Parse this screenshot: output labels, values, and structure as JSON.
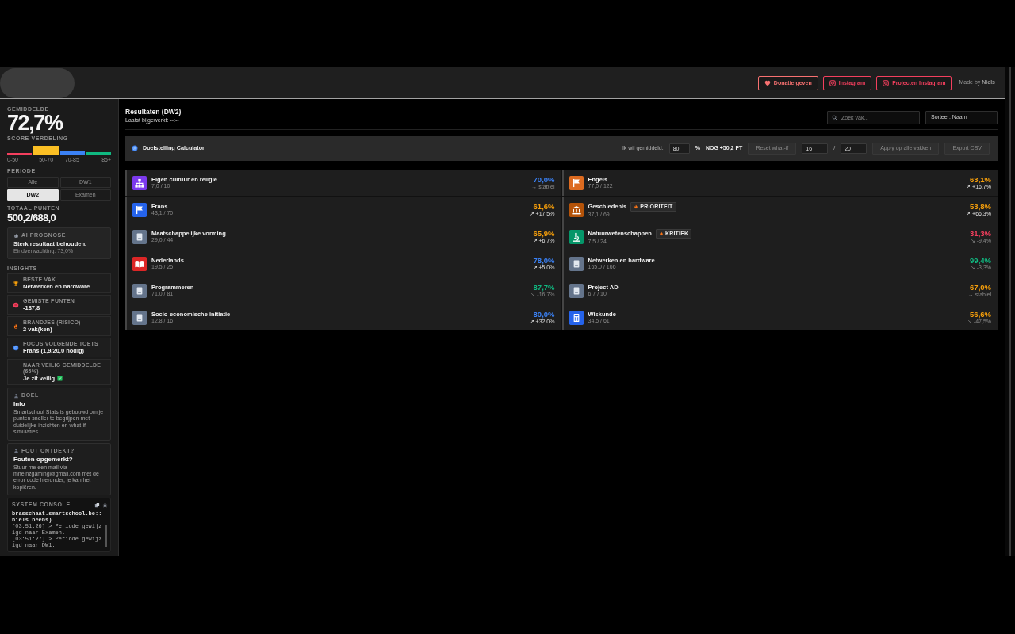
{
  "header": {
    "buttons": [
      {
        "label": "Donatie geven",
        "kind": "donate",
        "color": "#f87171"
      },
      {
        "label": "Instagram",
        "kind": "social",
        "color": "#f43f5e"
      },
      {
        "label": "Projecten Instagram",
        "kind": "social",
        "color": "#f43f5e"
      }
    ],
    "credit": "Made by **Niels**"
  },
  "sidebar": {
    "average": {
      "label": "GEMIDDELDE",
      "value": "72,7%"
    },
    "distribution": {
      "label": "SCORE VERDELING",
      "bins": [
        {
          "label": "0-50",
          "color": "#f43f5e"
        },
        {
          "label": "50-70",
          "color": "#fbbf24"
        },
        {
          "label": "70-85",
          "color": "#3b82f6"
        },
        {
          "label": "85+",
          "color": "#10b981"
        }
      ]
    },
    "period": {
      "label": "PERIODE",
      "options": [
        {
          "label": "Alle",
          "selected": false
        },
        {
          "label": "DW1",
          "selected": false
        },
        {
          "label": "DW2",
          "selected": true
        },
        {
          "label": "Examen",
          "selected": false
        }
      ]
    },
    "total": {
      "label": "TOTAAL PUNTEN",
      "value": "500,2/688,0"
    },
    "prognosis": {
      "label": "AI PROGNOSE",
      "headline": "Sterk resultaat behouden.",
      "detail": "Eindverwachting: 73,0%"
    },
    "insights": {
      "label": "INSIGHTS",
      "items": [
        {
          "kind": "trophy",
          "label": "BESTE VAK",
          "value": "Netwerken en hardware",
          "check": false
        },
        {
          "kind": "minus",
          "label": "GEMISTE PUNTEN",
          "value": "-187,8",
          "check": false
        },
        {
          "kind": "fire",
          "label": "BRANDJES (RISICO)",
          "value": "2 vak(ken)",
          "check": false
        },
        {
          "kind": "target",
          "label": "FOCUS VOLGENDE TOETS",
          "value": "Frans (1,9/20,0 nodig)",
          "check": false
        },
        {
          "kind": "none",
          "label": "NAAR VEILIG GEMIDDELDE (65%)",
          "value": "Je zit veilig",
          "check": true
        }
      ]
    },
    "info": {
      "label": "DOEL",
      "title": "Info",
      "text": "Smartschool Stats is gebouwd om je punten sneller te begrijpen met duidelijke inzichten en what-if simulaties."
    },
    "report": {
      "label": "FOUT ONTDEKT?",
      "title": "Fouten opgemerkt?",
      "text": "Stuur me een mail via mneinzgaming@gmail.com met de error code hieronder, je kan het kopiëren."
    },
    "console": {
      "title": "SYSTEM CONSOLE",
      "lines": [
        "brasschaat.smartschool.be::niels heens).",
        "[03:51:26] > Periode gewijzigd naar Examen.",
        "[03:51:27] > Periode gewijzigd naar DW1."
      ]
    }
  },
  "main": {
    "title": "Resultaten (DW2)",
    "updated": "Laatst bijgewerkt: --:--",
    "search": {
      "placeholder": "Zoek vak..."
    },
    "sort": {
      "value": "Sorteer: Naam"
    },
    "calculator": {
      "title": "Doelstelling Calculator",
      "target_label": "Ik wil gemiddeld:",
      "target": "80",
      "unit": "%",
      "needed": "NOG +50,2 PT",
      "reset": {
        "label": "Reset what-if",
        "disabled": true
      },
      "score": "16",
      "separator": "/",
      "max": "20",
      "apply": {
        "label": "Apply op alle vakken",
        "disabled": true
      },
      "export": {
        "label": "Export CSV",
        "disabled": true
      }
    },
    "subjects": [
      {
        "name": "Eigen cultuur en religie",
        "points": "7,0 / 10",
        "icon": {
          "kind": "sitemap",
          "color": "#7c3aed"
        },
        "score": {
          "text": "70,0%",
          "color": "#3b82f6"
        },
        "trend": {
          "kind": "flat",
          "text": "→ stabiel"
        }
      },
      {
        "name": "Engels",
        "points": "77,0 / 122",
        "icon": {
          "kind": "flag",
          "color": "#dd6b20"
        },
        "score": {
          "text": "63,1%",
          "color": "#f59e0b"
        },
        "trend": {
          "kind": "up",
          "text": "↗ +16,7%"
        }
      },
      {
        "name": "Frans",
        "points": "43,1 / 70",
        "icon": {
          "kind": "flag",
          "color": "#2563eb"
        },
        "score": {
          "text": "61,6%",
          "color": "#f59e0b"
        },
        "trend": {
          "kind": "up",
          "text": "↗ +17,5%"
        }
      },
      {
        "name": "Geschiedenis",
        "points": "37,1 / 69",
        "icon": {
          "kind": "landmark",
          "color": "#b45309"
        },
        "score": {
          "text": "53,8%",
          "color": "#f59e0b"
        },
        "trend": {
          "kind": "up",
          "text": "↗ +66,3%"
        },
        "badge": "PRIORITEIT"
      },
      {
        "name": "Maatschappelijke vorming",
        "points": "29,0 / 44",
        "icon": {
          "kind": "book",
          "color": "#64748b"
        },
        "score": {
          "text": "65,9%",
          "color": "#f59e0b"
        },
        "trend": {
          "kind": "up",
          "text": "↗ +6,7%"
        }
      },
      {
        "name": "Natuurwetenschappen",
        "points": "7,5 / 24",
        "icon": {
          "kind": "microscope",
          "color": "#059669"
        },
        "score": {
          "text": "31,3%",
          "color": "#f43f5e"
        },
        "trend": {
          "kind": "down",
          "text": "↘ -9,4%"
        },
        "badge": "KRITIEK"
      },
      {
        "name": "Nederlands",
        "points": "19,5 / 25",
        "icon": {
          "kind": "open-book",
          "color": "#dc2626"
        },
        "score": {
          "text": "78,0%",
          "color": "#3b82f6"
        },
        "trend": {
          "kind": "up",
          "text": "↗ +5,0%"
        }
      },
      {
        "name": "Netwerken en hardware",
        "points": "165,0 / 166",
        "icon": {
          "kind": "book",
          "color": "#64748b"
        },
        "score": {
          "text": "99,4%",
          "color": "#10b981"
        },
        "trend": {
          "kind": "down",
          "text": "↘ -3,3%"
        }
      },
      {
        "name": "Programmeren",
        "points": "71,0 / 81",
        "icon": {
          "kind": "book",
          "color": "#64748b"
        },
        "score": {
          "text": "87,7%",
          "color": "#10b981"
        },
        "trend": {
          "kind": "down",
          "text": "↘ -16,7%"
        }
      },
      {
        "name": "Project AD",
        "points": "6,7 / 10",
        "icon": {
          "kind": "book",
          "color": "#64748b"
        },
        "score": {
          "text": "67,0%",
          "color": "#f59e0b"
        },
        "trend": {
          "kind": "flat",
          "text": "→ stabiel"
        }
      },
      {
        "name": "Socio-economische initiatie",
        "points": "12,8 / 16",
        "icon": {
          "kind": "book",
          "color": "#64748b"
        },
        "score": {
          "text": "80,0%",
          "color": "#3b82f6"
        },
        "trend": {
          "kind": "up",
          "text": "↗ +32,0%"
        }
      },
      {
        "name": "Wiskunde",
        "points": "34,5 / 61",
        "icon": {
          "kind": "calculator",
          "color": "#2563eb"
        },
        "score": {
          "text": "56,6%",
          "color": "#f59e0b"
        },
        "trend": {
          "kind": "down",
          "text": "↘ -47,5%"
        }
      }
    ]
  }
}
